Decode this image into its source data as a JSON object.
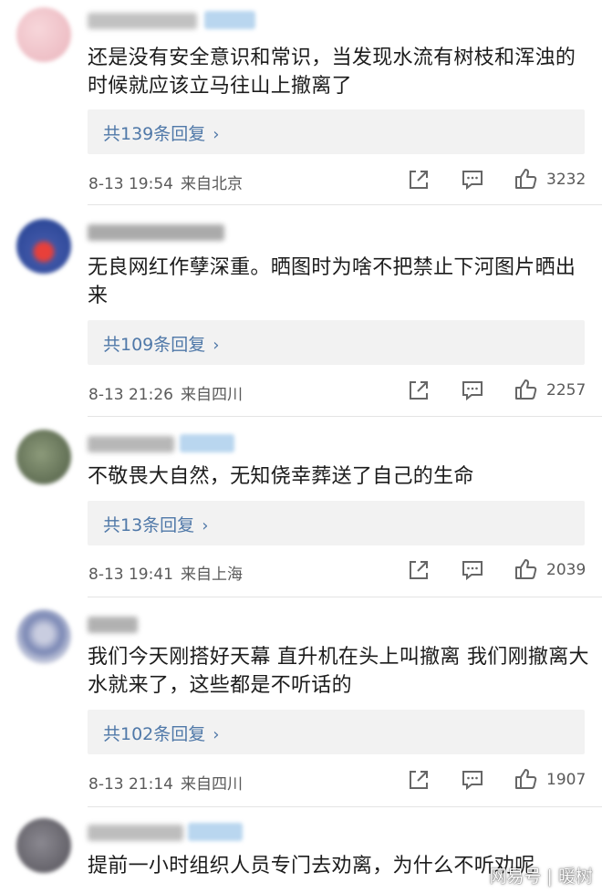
{
  "comments": [
    {
      "text": "还是没有安全意识和常识，当发现水流有树枝和浑浊的时候就应该立马往山上撤离了",
      "replies": "共139条回复",
      "time": "8-13 19:54",
      "location": "来自北京",
      "likes": "3232",
      "avatar_color": "#f2c6cc"
    },
    {
      "text": "无良网红作孽深重。晒图时为啥不把禁止下河图片晒出来",
      "replies": "共109条回复",
      "time": "8-13 21:26",
      "location": "来自四川",
      "likes": "2257",
      "avatar_color": "#3f56a8"
    },
    {
      "text": "不敬畏大自然，无知侥幸葬送了自己的生命",
      "replies": "共13条回复",
      "time": "8-13 19:41",
      "location": "来自上海",
      "likes": "2039",
      "avatar_color": "#6c7a5c"
    },
    {
      "text": "我们今天刚搭好天幕 直升机在头上叫撤离 我们刚撤离大水就来了，这些都是不听话的",
      "replies": "共102条回复",
      "time": "8-13 21:14",
      "location": "来自四川",
      "likes": "1907",
      "avatar_color": "#7a87b4"
    },
    {
      "text": "提前一小时组织人员专门去劝离，为什么不听劝呢",
      "avatar_color": "#6a6870"
    }
  ],
  "icons": {
    "share": "share-icon",
    "comment": "comment-icon",
    "like": "thumbs-up-icon"
  },
  "watermark": "网易号 | 暖树",
  "colors": {
    "link": "#4f78a8",
    "reply_bg": "#f2f2f2",
    "meta": "#5a5a5a"
  }
}
